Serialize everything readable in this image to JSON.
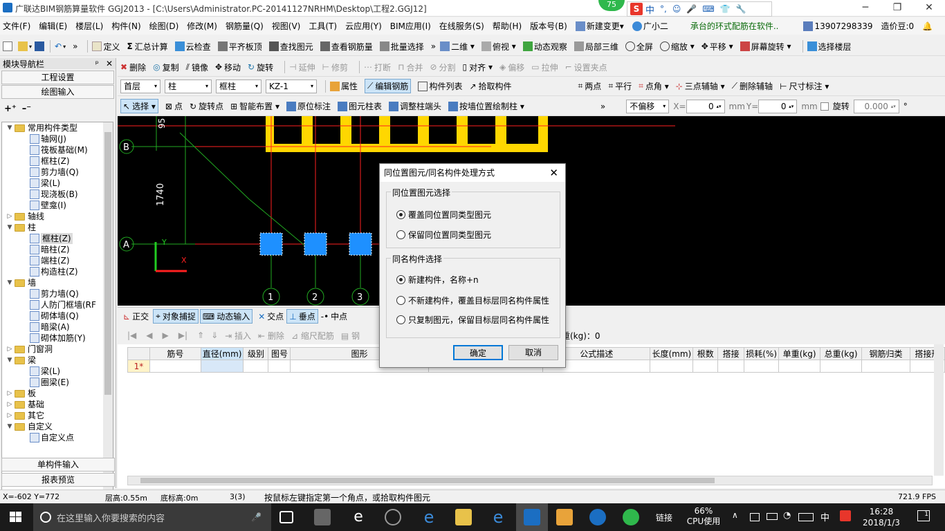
{
  "window": {
    "title": "广联达BIM钢筋算量软件 GGJ2013 - [C:\\Users\\Administrator.PC-20141127NRHM\\Desktop\\工程2.GGJ12]",
    "badge": "75",
    "minimize": "─",
    "restore": "❐",
    "close": "✕"
  },
  "ime": {
    "items": [
      "中",
      "°,",
      "☺",
      "🎤",
      "⌨",
      "👕",
      "🔧"
    ]
  },
  "menu": {
    "items": [
      "文件(F)",
      "编辑(E)",
      "楼层(L)",
      "构件(N)",
      "绘图(D)",
      "修改(M)",
      "钢筋量(Q)",
      "视图(V)",
      "工具(T)",
      "云应用(Y)",
      "BIM应用(I)",
      "在线服务(S)",
      "帮助(H)",
      "版本号(B)"
    ],
    "new_change": "新建变更",
    "xiaoer": "广小二",
    "marquee": "承台的环式配筋在软件..",
    "phone": "13907298339",
    "price": "造价豆:0"
  },
  "toolbar1": {
    "items": [
      "定义",
      "汇总计算",
      "云检查",
      "平齐板顶",
      "查找图元",
      "查看钢筋量",
      "批量选择",
      "二维",
      "俯视",
      "动态观察",
      "局部三维",
      "全屏",
      "缩放",
      "平移",
      "屏幕旋转",
      "选择楼层"
    ]
  },
  "nav": {
    "title": "模块导航栏",
    "pin": "ᵖ",
    "close": "✕",
    "btn_project": "工程设置",
    "btn_draw": "绘图输入",
    "btn_single": "单构件输入",
    "btn_report": "报表预览",
    "tree": [
      {
        "lv": 0,
        "open": true,
        "label": "常用构件类型"
      },
      {
        "lv": 2,
        "label": "轴网(J)"
      },
      {
        "lv": 2,
        "label": "筏板基础(M)"
      },
      {
        "lv": 2,
        "label": "框柱(Z)"
      },
      {
        "lv": 2,
        "label": "剪力墙(Q)"
      },
      {
        "lv": 2,
        "label": "梁(L)"
      },
      {
        "lv": 2,
        "label": "现浇板(B)"
      },
      {
        "lv": 2,
        "label": "壁龛(I)"
      },
      {
        "lv": 0,
        "open": false,
        "label": "轴线"
      },
      {
        "lv": 0,
        "open": true,
        "label": "柱"
      },
      {
        "lv": 2,
        "label": "框柱(Z)",
        "sel": true
      },
      {
        "lv": 2,
        "label": "暗柱(Z)"
      },
      {
        "lv": 2,
        "label": "端柱(Z)"
      },
      {
        "lv": 2,
        "label": "构造柱(Z)"
      },
      {
        "lv": 0,
        "open": true,
        "label": "墙"
      },
      {
        "lv": 2,
        "label": "剪力墙(Q)"
      },
      {
        "lv": 2,
        "label": "人防门框墙(RF"
      },
      {
        "lv": 2,
        "label": "砌体墙(Q)"
      },
      {
        "lv": 2,
        "label": "暗梁(A)"
      },
      {
        "lv": 2,
        "label": "砌体加筋(Y)"
      },
      {
        "lv": 0,
        "open": false,
        "label": "门窗洞"
      },
      {
        "lv": 0,
        "open": true,
        "label": "梁"
      },
      {
        "lv": 2,
        "label": "梁(L)"
      },
      {
        "lv": 2,
        "label": "圈梁(E)"
      },
      {
        "lv": 0,
        "open": false,
        "label": "板"
      },
      {
        "lv": 0,
        "open": false,
        "label": "基础"
      },
      {
        "lv": 0,
        "open": false,
        "label": "其它"
      },
      {
        "lv": 0,
        "open": true,
        "label": "自定义"
      },
      {
        "lv": 2,
        "label": "自定义点"
      }
    ]
  },
  "toolbar2": {
    "items": [
      "删除",
      "复制",
      "镜像",
      "移动",
      "旋转",
      "延伸",
      "修剪",
      "打断",
      "合并",
      "分割",
      "对齐",
      "偏移",
      "拉伸",
      "设置夹点"
    ]
  },
  "toolbar3": {
    "floor": "首层",
    "type": "柱",
    "subtype": "框柱",
    "comp": "KZ-1",
    "items": [
      "属性",
      "编辑钢筋",
      "构件列表",
      "拾取构件",
      "两点",
      "平行",
      "点角",
      "三点辅轴",
      "删除辅轴",
      "尺寸标注"
    ]
  },
  "toolbar4": {
    "items": [
      "选择",
      "点",
      "旋转点",
      "智能布置",
      "原位标注",
      "图元柱表",
      "调整柱端头",
      "按墙位置绘制柱"
    ],
    "offset": "不偏移",
    "x_label": "X=",
    "x_val": "0",
    "y_label": "Y=",
    "y_val": "0",
    "unit": "mm",
    "rotate_label": "旋转",
    "rotate_val": "0.000",
    "deg": "°"
  },
  "canvas": {
    "dim1": "95",
    "dim2": "1740",
    "axis_b": "B",
    "axis_a": "A",
    "col1": "1",
    "col2": "2",
    "col3": "3",
    "y": "Y",
    "x": "X"
  },
  "snapbar": {
    "items": [
      "正交",
      "对象捕捉",
      "动态输入",
      "交点",
      "垂点",
      "中点"
    ]
  },
  "gridtoolbar": {
    "items": [
      "插入",
      "删除",
      "缩尺配筋",
      "钢"
    ],
    "total": "筋总重(kg)：0"
  },
  "grid": {
    "headers": [
      "筋号",
      "直径(mm)",
      "级别",
      "图号",
      "图形",
      "",
      "公式描述",
      "长度(mm)",
      "根数",
      "搭接",
      "损耗(%)",
      "单重(kg)",
      "总重(kg)",
      "钢筋归类",
      "搭接形"
    ],
    "row1": "1*"
  },
  "dialog": {
    "title": "同位置图元/同名构件处理方式",
    "group1": "同位置图元选择",
    "opt1a": "覆盖同位置同类型图元",
    "opt1b": "保留同位置同类型图元",
    "group2": "同名构件选择",
    "opt2a": "新建构件，名称+n",
    "opt2b": "不新建构件，覆盖目标层同名构件属性",
    "opt2c": "只复制图元，保留目标层同名构件属性",
    "ok": "确定",
    "cancel": "取消"
  },
  "status": {
    "coords": "X=-602 Y=772",
    "floor_h": "层高:0.55m",
    "base_h": "底标高:0m",
    "count": "3(3)",
    "hint": "按鼠标左键指定第一个角点，或拾取构件图元",
    "fps": "721.9 FPS"
  },
  "taskbar": {
    "search": "在这里输入你要搜索的内容",
    "link": "链接",
    "cpu_pct": "66%",
    "cpu": "CPU使用",
    "ime": "中",
    "time": "16:28",
    "date": "2018/1/3",
    "notif": "1"
  },
  "colors": {
    "canvas_bg": "#000000",
    "column": "#1e90ff",
    "beam": "#ffd700",
    "axis": "#ff2020",
    "dim": "#22aa22"
  }
}
